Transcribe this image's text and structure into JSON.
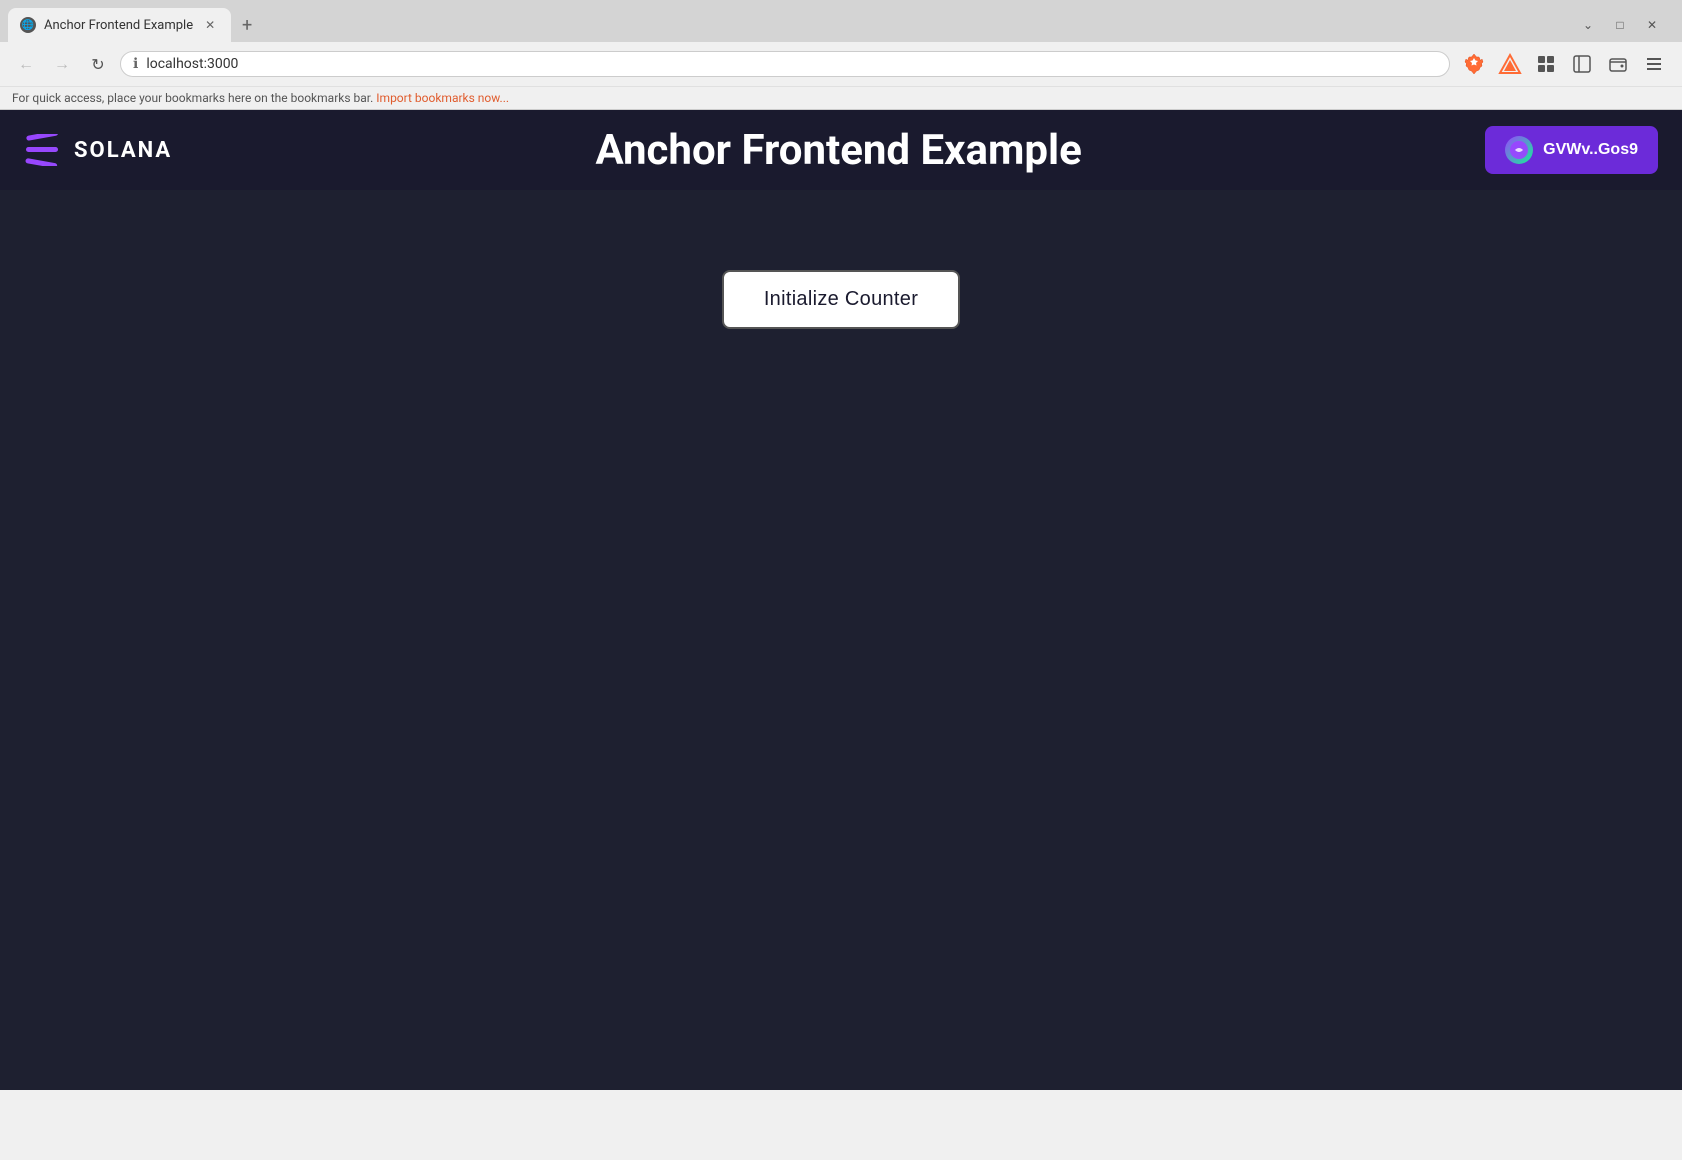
{
  "browser": {
    "tab": {
      "title": "Anchor Frontend Example",
      "favicon": "🌐"
    },
    "address": "localhost:3000",
    "bookmarks_text": "For quick access, place your bookmarks here on the bookmarks bar.",
    "bookmarks_link": "Import bookmarks now..."
  },
  "header": {
    "logo_text": "SOLANA",
    "app_title": "Anchor Frontend Example",
    "wallet_label": "GVWv..Gos9"
  },
  "main": {
    "init_button_label": "Initialize Counter"
  },
  "window_controls": {
    "minimize": "—",
    "maximize": "□",
    "close": "✕"
  }
}
